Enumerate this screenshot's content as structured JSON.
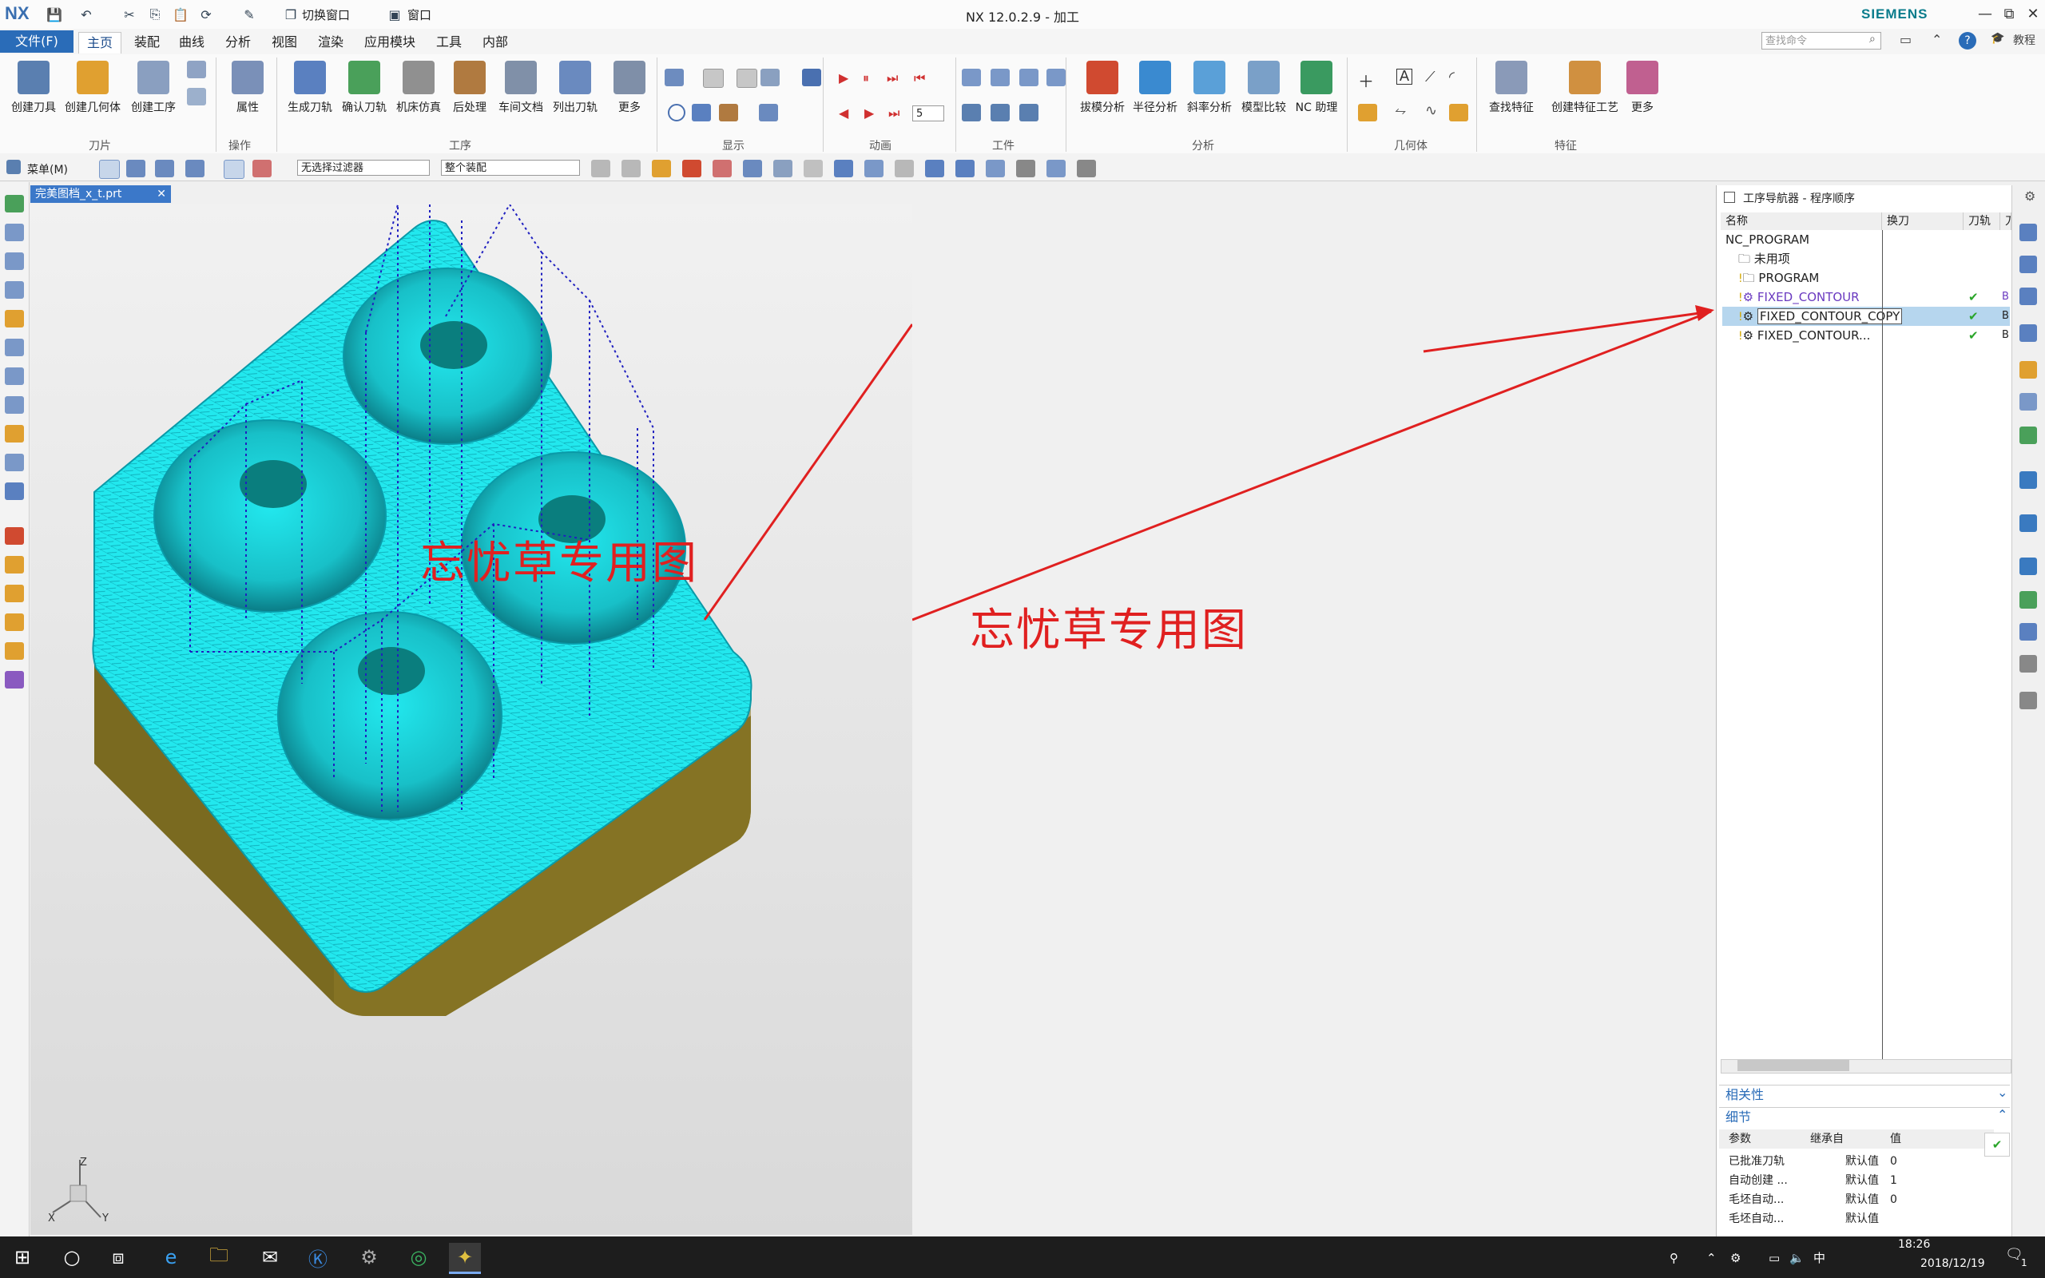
{
  "window": {
    "app_logo": "NX",
    "title": "NX 12.0.2.9 - 加工",
    "brand": "SIEMENS",
    "quick_access": {
      "switch_window": "切换窗口",
      "window": "窗口"
    },
    "controls": [
      "—",
      "⧉",
      "✕"
    ]
  },
  "menu": {
    "file": "文件(F)",
    "tabs": [
      "主页",
      "装配",
      "曲线",
      "分析",
      "视图",
      "渲染",
      "应用模块",
      "工具",
      "内部"
    ],
    "active_tab": "主页",
    "search_placeholder": "查找命令",
    "tutorial": "教程"
  },
  "ribbon": {
    "buttons": [
      {
        "label": "创建刀具",
        "color": "#5a7fb0"
      },
      {
        "label": "创建几何体",
        "color": "#e0a030"
      },
      {
        "label": "创建工序",
        "color": "#8a9fc0"
      },
      {
        "label": "属性",
        "color": "#7a90b8"
      },
      {
        "label": "生成刀轨",
        "color": "#5a80c0"
      },
      {
        "label": "确认刀轨",
        "color": "#4aa05a"
      },
      {
        "label": "机床仿真",
        "color": "#909090"
      },
      {
        "label": "后处理",
        "color": "#b07a40"
      },
      {
        "label": "车间文档",
        "color": "#8090a8"
      },
      {
        "label": "列出刀轨",
        "color": "#6a8abf"
      },
      {
        "label": "更多",
        "color": "#7f8fa8"
      },
      {
        "label": "拔模分析",
        "color": "#d04a30"
      },
      {
        "label": "半径分析",
        "color": "#3a8ad0"
      },
      {
        "label": "斜率分析",
        "color": "#5aa0d8"
      },
      {
        "label": "模型比较",
        "color": "#7aa0c8"
      },
      {
        "label": "NC 助理",
        "color": "#3a9a60"
      },
      {
        "label": "查找特征",
        "color": "#8a9ab8"
      },
      {
        "label": "创建特征工艺",
        "color": "#d09040"
      },
      {
        "label": "更多",
        "color": "#c06090"
      }
    ],
    "groups": [
      "刀片",
      "操作",
      "工序",
      "显示",
      "动画",
      "工件",
      "分析",
      "几何体",
      "特征"
    ],
    "speed_value": "5"
  },
  "filterbar": {
    "menu_label": "菜单(M)",
    "type_filter": "无选择过滤器",
    "scope": "整个装配"
  },
  "document": {
    "tab": "完美图档_x_t.prt"
  },
  "viewport": {
    "watermark_1": "忘忧草专用图",
    "watermark_2": "忘忧草专用图",
    "axes": {
      "x": "X",
      "y": "Y",
      "z": "Z"
    },
    "colors": {
      "toolpath": "#22e8ee",
      "body": "#7a6a20",
      "annotation": "#e02020",
      "rapid": "#2020c0"
    }
  },
  "navigator": {
    "title": "工序导航器 - 程序顺序",
    "columns": [
      "名称",
      "换刀",
      "刀轨",
      "刀"
    ],
    "rows": [
      {
        "name": "NC_PROGRAM",
        "toolpath": "",
        "extra": ""
      },
      {
        "name": "未用项",
        "toolpath": "",
        "extra": ""
      },
      {
        "name": "PROGRAM",
        "toolpath": "",
        "extra": ""
      },
      {
        "name": "FIXED_CONTOUR",
        "toolpath": "✔",
        "extra": "B"
      },
      {
        "name": "FIXED_CONTOUR_COPY",
        "toolpath": "✔",
        "extra": "B"
      },
      {
        "name": "FIXED_CONTOUR...",
        "toolpath": "✔",
        "extra": "B"
      }
    ],
    "sections": {
      "dependencies": "相关性",
      "details": "细节"
    },
    "details_header": [
      "参数",
      "继承自",
      "值"
    ],
    "details_rows": [
      {
        "param": "已批准刀轨",
        "inherit": "默认值",
        "value": "0"
      },
      {
        "param": "自动创建 ...",
        "inherit": "默认值",
        "value": "1"
      },
      {
        "param": "毛坯自动...",
        "inherit": "默认值",
        "value": "0"
      },
      {
        "param": "毛坯自动...",
        "inherit": "默认值",
        "value": ""
      }
    ]
  },
  "taskbar": {
    "time": "18:26",
    "date": "2018/12/19",
    "ime": "中",
    "notification_count": "1"
  }
}
